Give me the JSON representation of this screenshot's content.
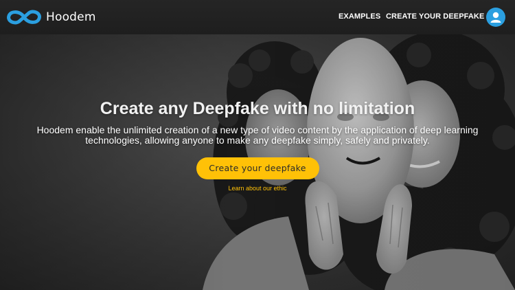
{
  "brand": {
    "name": "Hoodem",
    "logo_icon": "infinity-logo-icon",
    "logo_color": "#2b9fe0"
  },
  "nav": {
    "links": [
      {
        "label": "EXAMPLES"
      },
      {
        "label": "CREATE YOUR DEEPFAKE"
      }
    ],
    "profile_icon": "user-icon",
    "profile_color": "#2b9fe0"
  },
  "hero": {
    "title": "Create any Deepfake with no limitation",
    "subtitle": "Hoodem enable the unlimited creation of a new type of video content by the application of deep learning technologies, allowing anyone to make any deepfake simply, safely and privately.",
    "cta_label": "Create your deepfake",
    "ethic_link": "Learn about our ethic",
    "accent_color": "#ffc107",
    "background_image": "grayscale-photo-woman-holding-white-mask"
  }
}
